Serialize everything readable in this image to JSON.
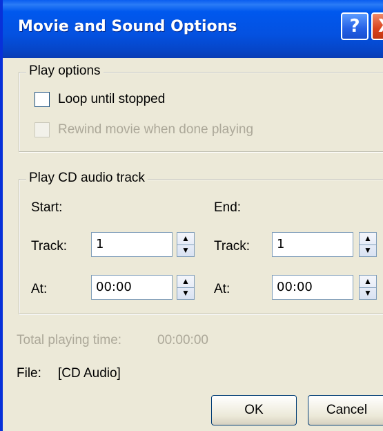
{
  "window": {
    "title": "Movie and Sound Options",
    "help_glyph": "?",
    "close_glyph": "X"
  },
  "play_options": {
    "group_label": "Play options",
    "loop_label": "Loop until stopped",
    "loop_checked": false,
    "rewind_label": "Rewind movie when done playing",
    "rewind_checked": false,
    "rewind_enabled": false
  },
  "cd_audio": {
    "group_label": "Play CD audio track",
    "start_label": "Start:",
    "end_label": "End:",
    "track_label": "Track:",
    "at_label": "At:",
    "start_track": "1",
    "start_at": "00:00",
    "end_track": "1",
    "end_at": "00:00"
  },
  "total_playing_time": {
    "label": "Total playing time:",
    "value": "00:00:00"
  },
  "file": {
    "label": "File:",
    "value": "[CD Audio]"
  },
  "buttons": {
    "ok": "OK",
    "cancel": "Cancel"
  },
  "colors": {
    "titlebar": "#0058ee",
    "dialog_bg": "#ece9d8",
    "disabled_text": "#aca899",
    "close_button": "#d9421c"
  }
}
